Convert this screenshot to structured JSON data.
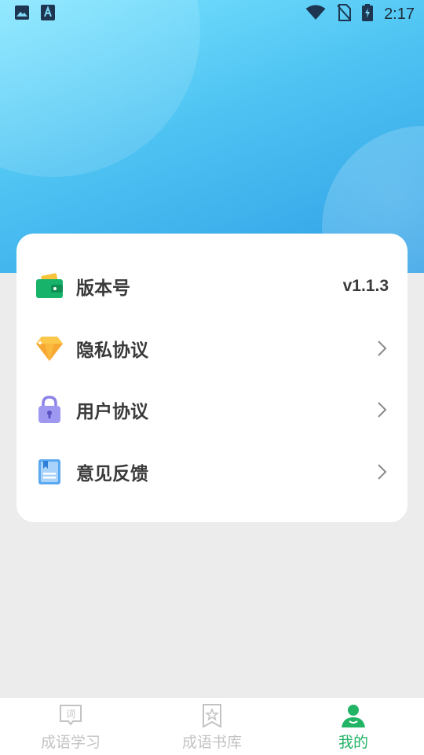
{
  "status_bar": {
    "time": "2:17",
    "left_icons": [
      "image-icon",
      "font-a-icon"
    ],
    "right_icons": [
      "wifi-icon",
      "no-sim-icon",
      "battery-charging-icon"
    ]
  },
  "settings": {
    "items": [
      {
        "label": "版本号",
        "icon": "wallet-icon",
        "value": "v1.1.3"
      },
      {
        "label": "隐私协议",
        "icon": "diamond-icon"
      },
      {
        "label": "用户协议",
        "icon": "lock-icon"
      },
      {
        "label": "意见反馈",
        "icon": "notebook-icon"
      }
    ]
  },
  "tab_bar": {
    "tabs": [
      {
        "label": "成语学习",
        "icon": "word-bubble-icon",
        "active": false
      },
      {
        "label": "成语书库",
        "icon": "bookmark-star-icon",
        "active": false
      },
      {
        "label": "我的",
        "icon": "user-icon",
        "active": true
      }
    ],
    "word_icon_glyph": "词"
  },
  "colors": {
    "hero_top": "#7be4ff",
    "hero_bottom": "#2f9ee6",
    "active_tab": "#22b465",
    "inactive_tab": "#c3c3c3",
    "background": "#ececec"
  }
}
